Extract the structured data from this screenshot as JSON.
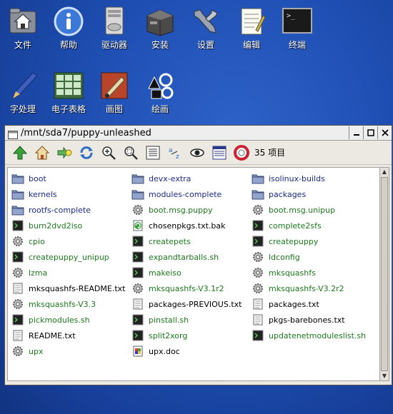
{
  "desktop": {
    "icons": [
      {
        "label": "文件",
        "icon": "home-icon"
      },
      {
        "label": "帮助",
        "icon": "info-icon"
      },
      {
        "label": "驱动器",
        "icon": "drive-icon"
      },
      {
        "label": "安装",
        "icon": "box-icon"
      },
      {
        "label": "设置",
        "icon": "wrench-icon"
      },
      {
        "label": "编辑",
        "icon": "notepad-icon"
      },
      {
        "label": "终端",
        "icon": "terminal-icon"
      },
      {
        "label": "字处理",
        "icon": "pen-icon"
      },
      {
        "label": "电子表格",
        "icon": "spreadsheet-icon"
      },
      {
        "label": "画图",
        "icon": "paint-icon"
      },
      {
        "label": "绘画",
        "icon": "draw-icon"
      }
    ]
  },
  "window": {
    "title": "/mnt/sda7/puppy-unleashed",
    "item_count": "35 项目"
  },
  "files": [
    {
      "name": "boot",
      "kind": "dir"
    },
    {
      "name": "devx-extra",
      "kind": "dir"
    },
    {
      "name": "isolinux-builds",
      "kind": "dir"
    },
    {
      "name": "kernels",
      "kind": "dir"
    },
    {
      "name": "modules-complete",
      "kind": "dir"
    },
    {
      "name": "packages",
      "kind": "dir"
    },
    {
      "name": "rootfs-complete",
      "kind": "dir"
    },
    {
      "name": "boot.msg.puppy",
      "kind": "gear"
    },
    {
      "name": "boot.msg.unipup",
      "kind": "gear"
    },
    {
      "name": "burn2dvd2iso",
      "kind": "script"
    },
    {
      "name": "chosenpkgs.txt.bak",
      "kind": "bak"
    },
    {
      "name": "complete2sfs",
      "kind": "script"
    },
    {
      "name": "cpio",
      "kind": "gear"
    },
    {
      "name": "createpets",
      "kind": "script"
    },
    {
      "name": "createpuppy",
      "kind": "script"
    },
    {
      "name": "createpuppy_unipup",
      "kind": "script"
    },
    {
      "name": "expandtarballs.sh",
      "kind": "script"
    },
    {
      "name": "ldconfig",
      "kind": "gear"
    },
    {
      "name": "lzma",
      "kind": "gear"
    },
    {
      "name": "makeiso",
      "kind": "script"
    },
    {
      "name": "mksquashfs",
      "kind": "gear"
    },
    {
      "name": "mksquashfs-README.txt",
      "kind": "text"
    },
    {
      "name": "mksquashfs-V3.1r2",
      "kind": "gear"
    },
    {
      "name": "mksquashfs-V3.2r2",
      "kind": "gear"
    },
    {
      "name": "mksquashfs-V3.3",
      "kind": "gear"
    },
    {
      "name": "packages-PREVIOUS.txt",
      "kind": "text"
    },
    {
      "name": "packages.txt",
      "kind": "text"
    },
    {
      "name": "pickmodules.sh",
      "kind": "script"
    },
    {
      "name": "pinstall.sh",
      "kind": "script"
    },
    {
      "name": "pkgs-barebones.txt",
      "kind": "text"
    },
    {
      "name": "README.txt",
      "kind": "text"
    },
    {
      "name": "split2xorg",
      "kind": "script"
    },
    {
      "name": "updatenetmoduleslist.sh",
      "kind": "script"
    },
    {
      "name": "upx",
      "kind": "gear"
    },
    {
      "name": "upx.doc",
      "kind": "doc"
    }
  ]
}
